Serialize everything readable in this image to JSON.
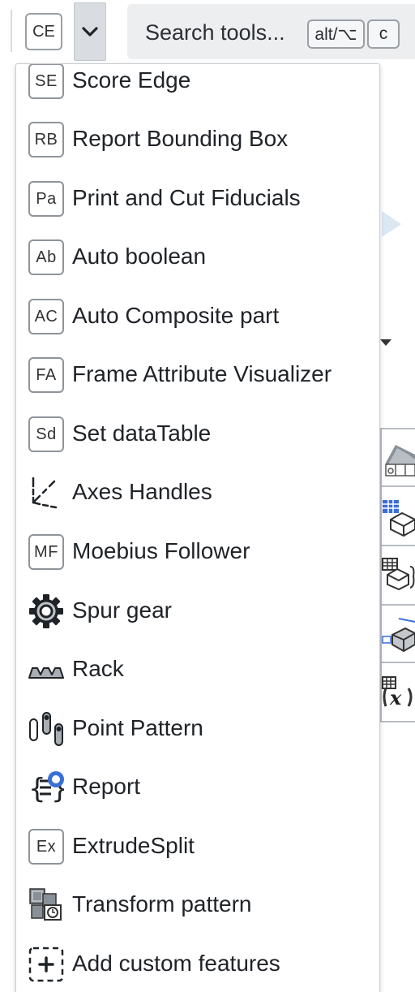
{
  "toolbar": {
    "current_tool_badge": "CE",
    "search": {
      "placeholder": "Search tools...",
      "shortcut_modifier": "alt/⌥",
      "shortcut_key": "c"
    }
  },
  "menu": {
    "items": [
      {
        "badge": "SE",
        "label": "Score Edge"
      },
      {
        "badge": "RB",
        "label": "Report Bounding Box"
      },
      {
        "badge": "Pa",
        "label": "Print and Cut Fiducials"
      },
      {
        "badge": "Ab",
        "label": "Auto boolean"
      },
      {
        "badge": "AC",
        "label": "Auto Composite part"
      },
      {
        "badge": "FA",
        "label": "Frame Attribute Visualizer"
      },
      {
        "badge": "Sd",
        "label": "Set dataTable"
      },
      {
        "icon": "axes-handles-icon",
        "label": "Axes Handles"
      },
      {
        "badge": "MF",
        "label": "Moebius Follower"
      },
      {
        "icon": "gear-icon",
        "label": "Spur gear"
      },
      {
        "icon": "rack-icon",
        "label": "Rack"
      },
      {
        "icon": "point-pattern-icon",
        "label": "Point Pattern"
      },
      {
        "icon": "report-icon",
        "label": "Report"
      },
      {
        "badge": "Ex",
        "label": "ExtrudeSplit"
      },
      {
        "icon": "transform-pattern-icon",
        "label": "Transform pattern"
      },
      {
        "icon": "add-custom-feature-icon",
        "label": "Add custom features"
      }
    ]
  },
  "colors": {
    "accent_blue": "#3a6fd8",
    "badge_border": "#8e949a",
    "panel_bg": "#ffffff"
  }
}
